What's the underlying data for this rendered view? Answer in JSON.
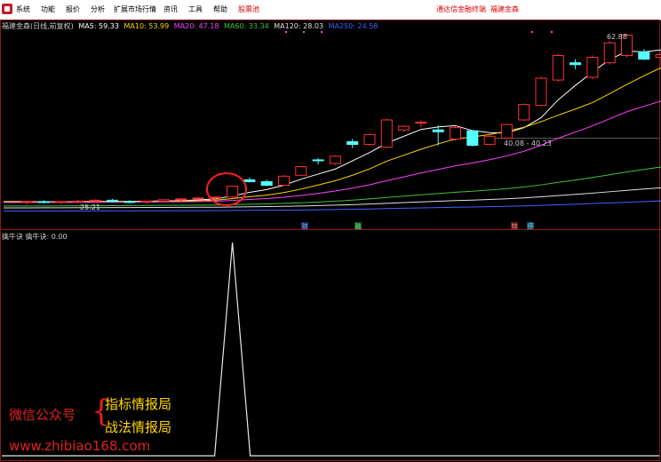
{
  "menu": {
    "items": [
      "系统",
      "功能",
      "报价",
      "分析",
      "扩展市场行情",
      "资讯",
      "工具",
      "帮助"
    ],
    "stock_picker": "股票池",
    "right_link": "通达信金融终端",
    "right_stock": "福建金森"
  },
  "legend": {
    "stock": "福建金森(日线,前复权)",
    "ma5": "MA5: 59.33",
    "ma10": "MA10: 53.99",
    "ma20": "MA20: 47.18",
    "ma60": "MA60: 33.34",
    "ma120": "MA120: 28.03",
    "ma250": "MA250: 24.58"
  },
  "colors": {
    "ma5": "#ffffff",
    "ma10": "#ffd700",
    "ma20": "#ff40ff",
    "ma60": "#40c040",
    "ma120": "#e0e0e0",
    "ma250": "#4060ff",
    "up": "#ff3030",
    "down": "#54ffff"
  },
  "labels": {
    "high": "62.88",
    "low": "25.21",
    "range": "40.08 - 40.23"
  },
  "markers": [
    "财",
    "融",
    "特",
    "停"
  ],
  "sub_legend": "擒牛诀  擒牛诀: 0.00",
  "watermark": {
    "line1": "微信公众号",
    "line2": "指标情报局",
    "line3": "战法情报局",
    "line4": "www.zhibiao168.com"
  },
  "chart_data": {
    "type": "candlestick",
    "candles": [
      [
        25.8,
        26.2,
        25.4,
        26.0
      ],
      [
        26.0,
        26.3,
        25.6,
        25.8
      ],
      [
        25.8,
        26.1,
        25.5,
        26.0
      ],
      [
        26.0,
        26.4,
        25.7,
        26.1
      ],
      [
        26.1,
        26.5,
        25.8,
        26.3
      ],
      [
        26.3,
        26.6,
        25.9,
        26.0
      ],
      [
        26.0,
        26.3,
        25.6,
        25.9
      ],
      [
        25.9,
        26.2,
        25.5,
        26.1
      ],
      [
        26.1,
        26.5,
        25.8,
        26.4
      ],
      [
        26.4,
        26.8,
        26.0,
        26.6
      ],
      [
        26.6,
        27.0,
        26.3,
        26.8
      ],
      [
        26.8,
        27.2,
        26.5,
        27.0
      ],
      [
        27.0,
        29.5,
        26.8,
        29.4
      ],
      [
        30.8,
        31.3,
        30.2,
        30.4
      ],
      [
        30.4,
        30.8,
        29.4,
        29.6
      ],
      [
        29.6,
        31.8,
        29.4,
        31.6
      ],
      [
        31.8,
        33.8,
        31.6,
        33.7
      ],
      [
        35.2,
        35.6,
        34.2,
        35.0
      ],
      [
        34.4,
        36.2,
        34.1,
        36.0
      ],
      [
        39.2,
        39.8,
        37.8,
        38.6
      ],
      [
        38.6,
        41.0,
        38.3,
        40.8
      ],
      [
        38.0,
        44.3,
        37.8,
        44.0
      ],
      [
        41.8,
        42.8,
        41.4,
        42.6
      ],
      [
        43.3,
        43.9,
        42.4,
        43.5
      ],
      [
        41.8,
        42.8,
        38.4,
        41.4
      ],
      [
        39.8,
        42.6,
        39.4,
        42.3
      ],
      [
        41.6,
        41.8,
        38.2,
        38.4
      ],
      [
        38.6,
        41.2,
        38.4,
        40.4
      ],
      [
        40.0,
        43.2,
        39.8,
        43.0
      ],
      [
        44.0,
        47.6,
        43.8,
        47.4
      ],
      [
        47.2,
        53.6,
        47.0,
        53.2
      ],
      [
        52.8,
        58.6,
        52.4,
        58.2
      ],
      [
        56.6,
        57.4,
        55.2,
        56.2
      ],
      [
        53.4,
        58.2,
        53.0,
        57.8
      ],
      [
        56.6,
        61.4,
        56.2,
        61.0
      ],
      [
        58.2,
        63.0,
        57.8,
        62.7
      ],
      [
        59.0,
        59.6,
        57.2,
        57.4
      ],
      [
        57.8,
        59.2,
        55.8,
        58.4
      ]
    ],
    "sub_indicator": {
      "name": "擒牛诀",
      "peak_index": 12,
      "peak_value": 1,
      "base_value": 0
    }
  }
}
